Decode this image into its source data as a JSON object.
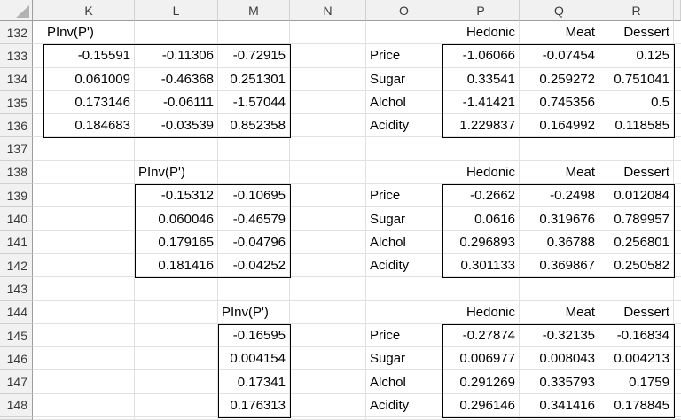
{
  "colors": {
    "header_bg": "#f1f1f1",
    "header_text": "#3a3a3a",
    "cell_text": "#000000",
    "gridline": "#e1e1e1",
    "header_gridline": "#d0d0d0",
    "header_edge": "#9e9e9e",
    "box_border": "#000000",
    "select_all_triangle": "#b2b2b2",
    "body_bg": "#ffffff"
  },
  "sheet": {
    "corner_label": "",
    "column_headers": [
      {
        "key": "J",
        "label": ""
      },
      {
        "key": "K",
        "label": "K"
      },
      {
        "key": "L",
        "label": "L"
      },
      {
        "key": "M",
        "label": "M"
      },
      {
        "key": "N",
        "label": "N"
      },
      {
        "key": "O",
        "label": "O"
      },
      {
        "key": "P",
        "label": "P"
      },
      {
        "key": "Q",
        "label": "Q"
      },
      {
        "key": "R",
        "label": "R"
      },
      {
        "key": "S",
        "label": ""
      }
    ],
    "right_aligned_labels": [
      "Hedonic",
      "Meat",
      "Dessert"
    ],
    "border_boxes": [
      "K133:M136",
      "P133:R136",
      "L139:M142",
      "P139:R142",
      "M145:M148",
      "P145:R148"
    ],
    "rows": [
      {
        "num": "132",
        "cells": {
          "K": "PInv(P')",
          "P": "Hedonic",
          "Q": "Meat",
          "R": "Dessert"
        }
      },
      {
        "num": "133",
        "cells": {
          "K": "-0.15591",
          "L": "-0.11306",
          "M": "-0.72915",
          "O": "Price",
          "P": "-1.06066",
          "Q": "-0.07454",
          "R": "0.125"
        }
      },
      {
        "num": "134",
        "cells": {
          "K": "0.061009",
          "L": "-0.46368",
          "M": "0.251301",
          "O": "Sugar",
          "P": "0.33541",
          "Q": "0.259272",
          "R": "0.751041"
        }
      },
      {
        "num": "135",
        "cells": {
          "K": "0.173146",
          "L": "-0.06111",
          "M": "-1.57044",
          "O": "Alchol",
          "P": "-1.41421",
          "Q": "0.745356",
          "R": "0.5"
        }
      },
      {
        "num": "136",
        "cells": {
          "K": "0.184683",
          "L": "-0.03539",
          "M": "0.852358",
          "O": "Acidity",
          "P": "1.229837",
          "Q": "0.164992",
          "R": "0.118585"
        }
      },
      {
        "num": "137",
        "cells": {}
      },
      {
        "num": "138",
        "cells": {
          "L": "PInv(P')",
          "P": "Hedonic",
          "Q": "Meat",
          "R": "Dessert"
        }
      },
      {
        "num": "139",
        "cells": {
          "L": "-0.15312",
          "M": "-0.10695",
          "O": "Price",
          "P": "-0.2662",
          "Q": "-0.2498",
          "R": "0.012084"
        }
      },
      {
        "num": "140",
        "cells": {
          "L": "0.060046",
          "M": "-0.46579",
          "O": "Sugar",
          "P": "0.0616",
          "Q": "0.319676",
          "R": "0.789957"
        }
      },
      {
        "num": "141",
        "cells": {
          "L": "0.179165",
          "M": "-0.04796",
          "O": "Alchol",
          "P": "0.296893",
          "Q": "0.36788",
          "R": "0.256801"
        }
      },
      {
        "num": "142",
        "cells": {
          "L": "0.181416",
          "M": "-0.04252",
          "O": "Acidity",
          "P": "0.301133",
          "Q": "0.369867",
          "R": "0.250582"
        }
      },
      {
        "num": "143",
        "cells": {}
      },
      {
        "num": "144",
        "cells": {
          "M": "PInv(P')",
          "P": "Hedonic",
          "Q": "Meat",
          "R": "Dessert"
        }
      },
      {
        "num": "145",
        "cells": {
          "M": "-0.16595",
          "O": "Price",
          "P": "-0.27874",
          "Q": "-0.32135",
          "R": "-0.16834"
        }
      },
      {
        "num": "146",
        "cells": {
          "M": "0.004154",
          "O": "Sugar",
          "P": "0.006977",
          "Q": "0.008043",
          "R": "0.004213"
        }
      },
      {
        "num": "147",
        "cells": {
          "M": "0.17341",
          "O": "Alchol",
          "P": "0.291269",
          "Q": "0.335793",
          "R": "0.1759"
        }
      },
      {
        "num": "148",
        "cells": {
          "M": "0.176313",
          "O": "Acidity",
          "P": "0.296146",
          "Q": "0.341416",
          "R": "0.178845"
        }
      }
    ]
  }
}
